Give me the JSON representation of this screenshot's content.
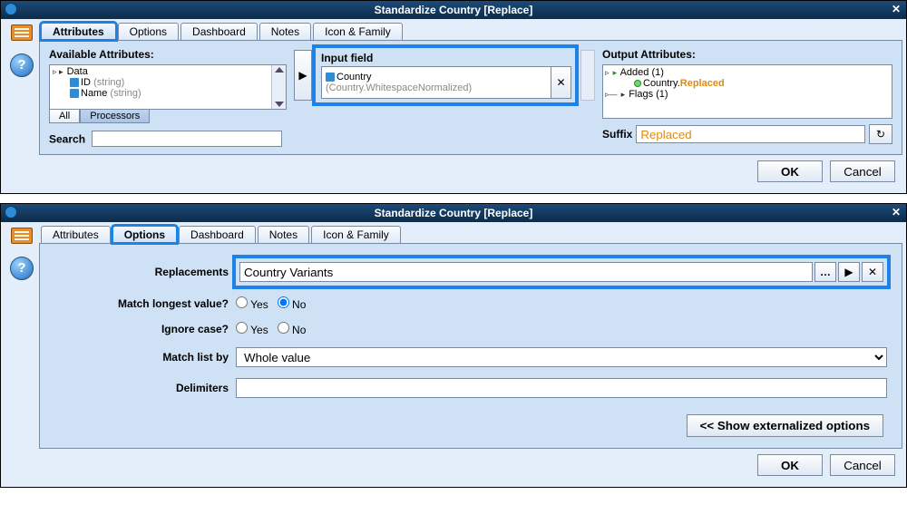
{
  "window1": {
    "title": "Standardize Country [Replace]",
    "tabs": [
      "Attributes",
      "Options",
      "Dashboard",
      "Notes",
      "Icon & Family"
    ],
    "activeTab": 0,
    "available": {
      "label": "Available Attributes:",
      "root": "Data",
      "items": [
        "ID",
        "Name"
      ],
      "item_types": [
        "(string)",
        "(string)"
      ],
      "subtabs": [
        "All",
        "Processors"
      ]
    },
    "searchLabel": "Search",
    "inputField": {
      "groupTitle": "Input field",
      "name": "Country",
      "detail": "(Country.WhitespaceNormalized)"
    },
    "output": {
      "label": "Output Attributes:",
      "added": "Added (1)",
      "addedItem": "Country.",
      "addedSuffix": "Replaced",
      "flags": "Flags (1)"
    },
    "suffixLabel": "Suffix",
    "suffixValue": "Replaced",
    "okLabel": "OK",
    "cancelLabel": "Cancel"
  },
  "window2": {
    "title": "Standardize Country [Replace]",
    "tabs": [
      "Attributes",
      "Options",
      "Dashboard",
      "Notes",
      "Icon & Family"
    ],
    "activeTab": 1,
    "replacementsLabel": "Replacements",
    "replacementsValue": "Country Variants",
    "matchLongestLabel": "Match longest value?",
    "ignoreCaseLabel": "Ignore case?",
    "matchListByLabel": "Match list by",
    "matchListByValue": "Whole value",
    "delimitersLabel": "Delimiters",
    "delimitersValue": "",
    "yesLabel": "Yes",
    "noLabel": "No",
    "externalizeLabel": "<< Show externalized options",
    "okLabel": "OK",
    "cancelLabel": "Cancel"
  }
}
